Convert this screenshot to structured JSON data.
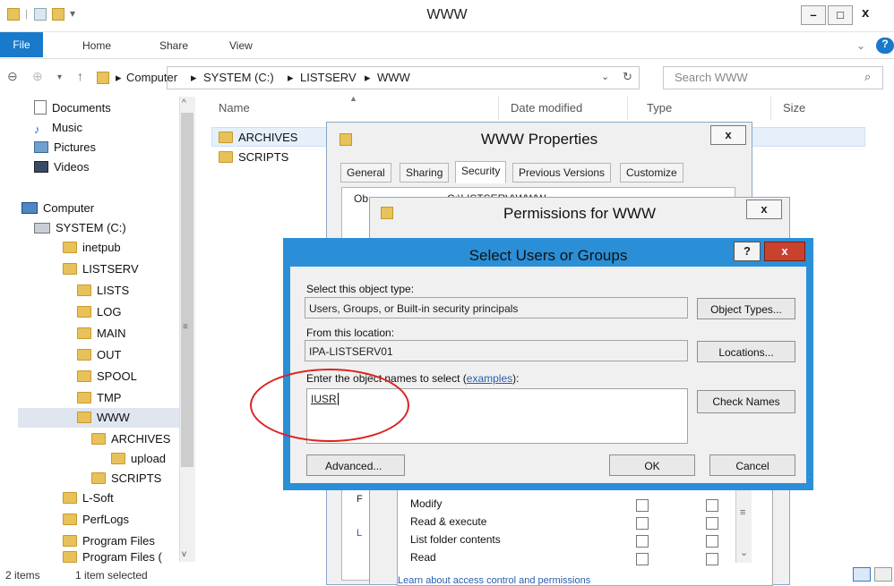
{
  "window": {
    "title": "WWW",
    "controls": [
      "–",
      "□",
      "x"
    ]
  },
  "ribbon": {
    "tabs": [
      "File",
      "Home",
      "Share",
      "View"
    ]
  },
  "address": {
    "crumbs": [
      "Computer",
      "SYSTEM (C:)",
      "LISTSERV",
      "WWW"
    ],
    "separator": "▸",
    "search_placeholder": "Search WWW"
  },
  "nav": {
    "items": [
      {
        "label": "Documents",
        "icon": "documents-icon"
      },
      {
        "label": "Music",
        "icon": "music-icon"
      },
      {
        "label": "Pictures",
        "icon": "pictures-icon"
      },
      {
        "label": "Videos",
        "icon": "videos-icon"
      },
      {
        "label": "Computer",
        "icon": "computer-icon"
      },
      {
        "label": "SYSTEM (C:)",
        "icon": "drive-icon"
      },
      {
        "label": "inetpub",
        "icon": "folder-icon"
      },
      {
        "label": "LISTSERV",
        "icon": "folder-icon"
      },
      {
        "label": "LISTS",
        "icon": "folder-icon"
      },
      {
        "label": "LOG",
        "icon": "folder-icon"
      },
      {
        "label": "MAIN",
        "icon": "folder-icon"
      },
      {
        "label": "OUT",
        "icon": "folder-icon"
      },
      {
        "label": "SPOOL",
        "icon": "folder-icon"
      },
      {
        "label": "TMP",
        "icon": "folder-icon"
      },
      {
        "label": "WWW",
        "icon": "folder-icon"
      },
      {
        "label": "ARCHIVES",
        "icon": "folder-icon"
      },
      {
        "label": "upload",
        "icon": "folder-icon"
      },
      {
        "label": "SCRIPTS",
        "icon": "folder-icon"
      },
      {
        "label": "L-Soft",
        "icon": "folder-icon"
      },
      {
        "label": "PerfLogs",
        "icon": "folder-icon"
      },
      {
        "label": "Program Files",
        "icon": "folder-icon"
      },
      {
        "label": "Program Files (",
        "icon": "folder-icon"
      }
    ]
  },
  "content": {
    "columns": [
      "Name",
      "Date modified",
      "Type",
      "Size"
    ],
    "files": [
      "ARCHIVES",
      "SCRIPTS"
    ]
  },
  "status": {
    "items": "2 items",
    "selected": "1 item selected"
  },
  "properties": {
    "title": "WWW Properties",
    "close": "x",
    "tabs": [
      "General",
      "Sharing",
      "Security",
      "Previous Versions",
      "Customize"
    ],
    "object_label_partial": "Ob",
    "object_path_partial": "C:\\LISTSERV\\WWW"
  },
  "permissions": {
    "title": "Permissions for WWW",
    "close": "x",
    "perm_rows": [
      "Modify",
      "Read & execute",
      "List folder contents",
      "Read"
    ],
    "learn_link": "Learn about access control and permissions"
  },
  "select_users": {
    "title": "Select Users or Groups",
    "help": "?",
    "close": "x",
    "object_type_label": "Select this object type:",
    "object_type_value": "Users, Groups, or Built-in security principals",
    "object_types_button": "Object Types...",
    "location_label": "From this location:",
    "location_value": "IPA-LISTSERV01",
    "locations_button": "Locations...",
    "enter_label": "Enter the object names to select (",
    "examples_link": "examples",
    "enter_label_end": "):",
    "entered_name": "IUSR",
    "check_names_button": "Check Names",
    "advanced_button": "Advanced...",
    "ok_button": "OK",
    "cancel_button": "Cancel"
  },
  "colors": {
    "accent": "#2a8fd6",
    "file_tab": "#1979ca",
    "close_red": "#c9422e",
    "highlight_circle": "#d22222"
  }
}
